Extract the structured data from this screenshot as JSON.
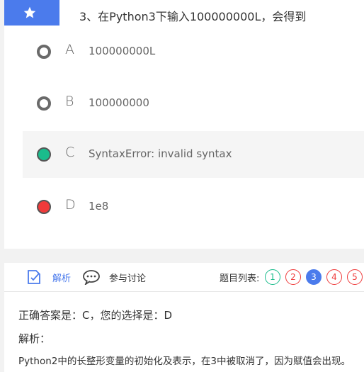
{
  "question": {
    "text": "3、在Python3下输入100000000L，会得到"
  },
  "options": [
    {
      "letter": "A",
      "text": "100000000L",
      "state": "unselected"
    },
    {
      "letter": "B",
      "text": "100000000",
      "state": "unselected"
    },
    {
      "letter": "C",
      "text": "SyntaxError: invalid syntax",
      "state": "correct"
    },
    {
      "letter": "D",
      "text": "1e8",
      "state": "wrong"
    }
  ],
  "tabs": {
    "analysis_label": "解析",
    "discuss_label": "参与讨论",
    "question_list_label": "题目列表:"
  },
  "question_list": [
    {
      "num": "1",
      "status": "correct"
    },
    {
      "num": "2",
      "status": "wrong"
    },
    {
      "num": "3",
      "status": "current"
    },
    {
      "num": "4",
      "status": "wrong"
    },
    {
      "num": "5",
      "status": "wrong"
    }
  ],
  "result": {
    "answer_line": "正确答案是：C，您的选择是：D",
    "analysis_heading": "解析：",
    "explanation": "Python2中的长整形变量的初始化及表示，在3中被取消了，因为赋值会出现。"
  },
  "colors": {
    "accent": "#4b7bec",
    "correct": "#1abc8c",
    "wrong": "#ef3b3b"
  },
  "icons": [
    "star-icon",
    "analysis-icon",
    "chat-bubble-icon"
  ]
}
